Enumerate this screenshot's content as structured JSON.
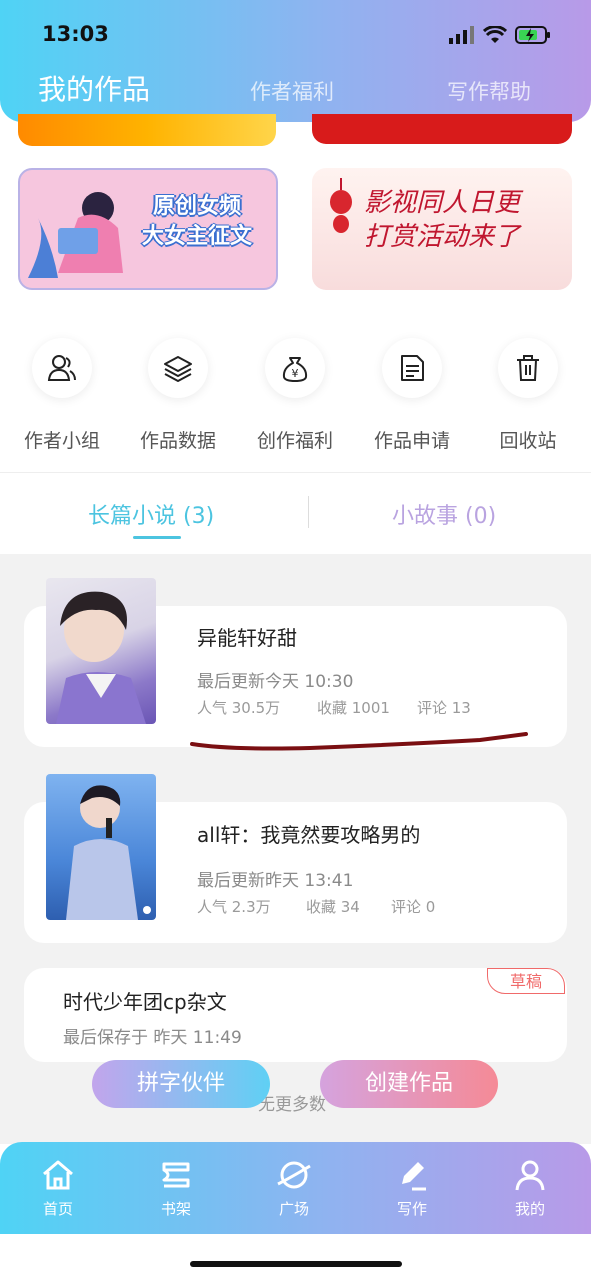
{
  "status": {
    "time": "13:03"
  },
  "header": {
    "title": "我的作品",
    "tabs": [
      {
        "label": "作者福利"
      },
      {
        "label": "写作帮助"
      }
    ]
  },
  "banners": {
    "left_text": [
      "原创女频",
      "大女主征文"
    ],
    "right_text": [
      "影视同人日更",
      "打赏活动来了"
    ]
  },
  "actions": [
    {
      "label": "作者小组",
      "icon": "people-icon"
    },
    {
      "label": "作品数据",
      "icon": "layers-icon"
    },
    {
      "label": "创作福利",
      "icon": "money-bag-icon"
    },
    {
      "label": "作品申请",
      "icon": "document-icon"
    },
    {
      "label": "回收站",
      "icon": "trash-icon"
    }
  ],
  "tabs": [
    {
      "label": "长篇小说 (3)",
      "active": true
    },
    {
      "label": "小故事 (0)",
      "active": false
    }
  ],
  "works": [
    {
      "title": "异能轩好甜",
      "updated": "最后更新今天 10:30",
      "popularity": "人气 30.5万",
      "favorites": "收藏 1001",
      "comments": "评论 13"
    },
    {
      "title": "all轩：我竟然要攻略男的",
      "updated": "最后更新昨天 13:41",
      "popularity": "人气 2.3万",
      "favorites": "收藏 34",
      "comments": "评论 0"
    }
  ],
  "draft": {
    "badge": "草稿",
    "title": "时代少年团cp杂文",
    "saved": "最后保存于 昨天 11:49"
  },
  "floating": {
    "left_button": "拼字伙伴",
    "right_button": "创建作品",
    "more_text": "无更多数"
  },
  "bottom_nav": [
    {
      "label": "首页",
      "icon": "home-icon"
    },
    {
      "label": "书架",
      "icon": "bookshelf-icon"
    },
    {
      "label": "广场",
      "icon": "planet-icon"
    },
    {
      "label": "写作",
      "icon": "pen-icon"
    },
    {
      "label": "我的",
      "icon": "user-icon"
    }
  ],
  "colors": {
    "accent": "#4cc4e0",
    "header_gradient_start": "#4fd3f5",
    "header_gradient_end": "#b89ae8",
    "inactive_tab": "#b9a3e0",
    "draft_badge": "#f06a6a"
  }
}
